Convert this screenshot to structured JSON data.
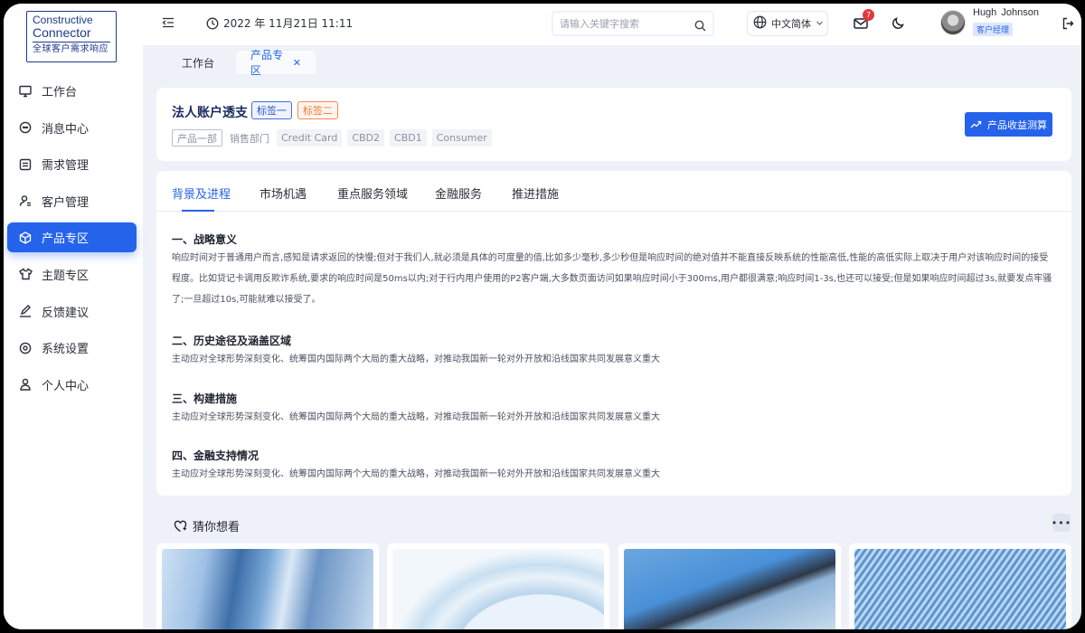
{
  "app": {
    "logo": {
      "line1": "Constructive",
      "line2": "Connector",
      "tagline": "全球客户需求响应"
    }
  },
  "sidebar": {
    "items": [
      {
        "label": "工作台",
        "icon": "monitor-icon",
        "active": false
      },
      {
        "label": "消息中心",
        "icon": "chat-icon",
        "active": false
      },
      {
        "label": "需求管理",
        "icon": "list-icon",
        "active": false
      },
      {
        "label": "客户管理",
        "icon": "user-manage-icon",
        "active": false
      },
      {
        "label": "产品专区",
        "icon": "cube-icon",
        "active": true
      },
      {
        "label": "主题专区",
        "icon": "shirt-icon",
        "active": false
      },
      {
        "label": "反馈建议",
        "icon": "pen-icon",
        "active": false
      },
      {
        "label": "系统设置",
        "icon": "settings-icon",
        "active": false
      },
      {
        "label": "个人中心",
        "icon": "person-icon",
        "active": false
      }
    ]
  },
  "topbar": {
    "datetime": "2022 年 11月21日 11:11",
    "search_placeholder": "请输入关键字搜索",
    "language": "中文简体",
    "mail_badge": "7",
    "user_name": "Hugh  Johnson",
    "user_role": "客户经理"
  },
  "page_tabs": [
    {
      "label": "工作台",
      "active": false
    },
    {
      "label": "产品专区",
      "active": true
    }
  ],
  "product": {
    "title": "法人账户透支",
    "tags": [
      "标签一",
      "标签二"
    ],
    "chips": [
      "产品一部",
      "销售部门",
      "Credit Card",
      "CBD2",
      "CBD1",
      "Consumer"
    ],
    "calc_button": "产品收益测算"
  },
  "content_tabs": [
    "背景及进程",
    "市场机遇",
    "重点服务领域",
    "金融服务",
    "推进措施"
  ],
  "sections": [
    {
      "title": "一、战略意义",
      "body": "响应时间对于普通用户而言,感知是请求返回的快慢;但对于我们人,就必须是具体的可度量的值,比如多少毫秒,多少秒但是响应时间的绝对值并不能直接反映系统的性能高低,性能的高低实际上取决于用户对该响应时间的接受程度。比如贷记卡调用反欺诈系统,要求的响应时间是50ms以内;对于行内用户使用的P2客户端,大多数页面访问如果响应时间小于300ms,用户都很满意;响应时间1-3s,也还可以接受;但是如果响应时间超过3s,就要发点牢骚了;一旦超过10s,可能就难以接受了。"
    },
    {
      "title": "二、历史途径及涵盖区域",
      "body": "主动应对全球形势深刻变化、统筹国内国际两个大局的重大战略，对推动我国新一轮对外开放和沿线国家共同发展意义重大"
    },
    {
      "title": "三、构建措施",
      "body": "主动应对全球形势深刻变化、统筹国内国际两个大局的重大战略，对推动我国新一轮对外开放和沿线国家共同发展意义重大"
    },
    {
      "title": "四、金融支持情况",
      "body": "主动应对全球形势深刻变化、统筹国内国际两个大局的重大战略，对推动我国新一轮对外开放和沿线国家共同发展意义重大"
    }
  ],
  "recommend": {
    "title": "猜你想看",
    "more": "•••"
  },
  "colors": {
    "primary": "#2563eb",
    "tag_orange": "#f07a3a",
    "badge": "#e5383b"
  }
}
